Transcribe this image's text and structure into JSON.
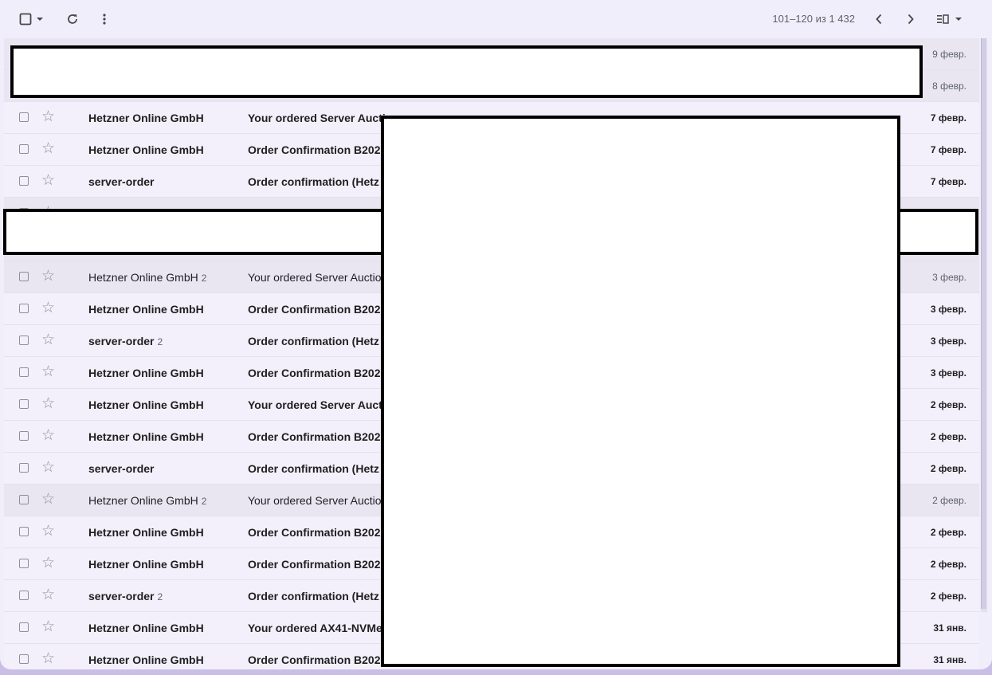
{
  "toolbar": {
    "select_icon": "checkbox-icon",
    "select_dropdown_icon": "chevron-down-icon",
    "refresh_icon": "refresh-icon",
    "more_icon": "more-vert-icon",
    "pagination": "101–120 из 1 432",
    "prev_icon": "chevron-left-icon",
    "next_icon": "chevron-right-icon",
    "density_icon": "split-pane-icon"
  },
  "emails": [
    {
      "sender": "",
      "count": "",
      "subject": "",
      "date": "9 февр.",
      "read": true
    },
    {
      "sender": "",
      "count": "",
      "subject": "",
      "date": "8 февр.",
      "read": true
    },
    {
      "sender": "Hetzner Online GmbH",
      "count": "",
      "subject": "Your ordered Server Aucti",
      "date": "7 февр.",
      "read": false
    },
    {
      "sender": "Hetzner Online GmbH",
      "count": "",
      "subject": "Order Confirmation B202",
      "date": "7 февр.",
      "read": false
    },
    {
      "sender": "server-order",
      "count": "",
      "subject": "Order confirmation (Hetz",
      "date": "7 февр.",
      "read": false
    },
    {
      "sender": "",
      "count": "",
      "subject": "",
      "date": "",
      "read": true
    },
    {
      "sender": "",
      "count": "",
      "subject": "",
      "date": "",
      "read": true
    },
    {
      "sender": "Hetzner Online GmbH",
      "count": "2",
      "subject": "Your ordered Server Auctio",
      "date": "3 февр.",
      "read": true
    },
    {
      "sender": "Hetzner Online GmbH",
      "count": "",
      "subject": "Order Confirmation B202",
      "date": "3 февр.",
      "read": false
    },
    {
      "sender": "server-order",
      "count": "2",
      "subject": "Order confirmation (Hetz",
      "date": "3 февр.",
      "read": false
    },
    {
      "sender": "Hetzner Online GmbH",
      "count": "",
      "subject": "Order Confirmation B202",
      "date": "3 февр.",
      "read": false
    },
    {
      "sender": "Hetzner Online GmbH",
      "count": "",
      "subject": "Your ordered Server Auct",
      "date": "2 февр.",
      "read": false
    },
    {
      "sender": "Hetzner Online GmbH",
      "count": "",
      "subject": "Order Confirmation B202",
      "date": "2 февр.",
      "read": false
    },
    {
      "sender": "server-order",
      "count": "",
      "subject": "Order confirmation (Hetz",
      "date": "2 февр.",
      "read": false
    },
    {
      "sender": "Hetzner Online GmbH",
      "count": "2",
      "subject": "Your ordered Server Auctio",
      "date": "2 февр.",
      "read": true
    },
    {
      "sender": "Hetzner Online GmbH",
      "count": "",
      "subject": "Order Confirmation B202",
      "date": "2 февр.",
      "read": false
    },
    {
      "sender": "Hetzner Online GmbH",
      "count": "",
      "subject": "Order Confirmation B202",
      "date": "2 февр.",
      "read": false
    },
    {
      "sender": "server-order",
      "count": "2",
      "subject": "Order confirmation (Hetz",
      "date": "2 февр.",
      "read": false
    },
    {
      "sender": "Hetzner Online GmbH",
      "count": "",
      "subject": "Your ordered AX41-NVMe",
      "date": "31 янв.",
      "read": false
    },
    {
      "sender": "Hetzner Online GmbH",
      "count": "",
      "subject": "Order Confirmation B202",
      "date": "31 янв.",
      "read": false
    }
  ],
  "colors": {
    "background": "#c9bfe6",
    "panel": "#f1eefb",
    "read_row": "#e9e6f2",
    "redaction": "#ffffff"
  }
}
